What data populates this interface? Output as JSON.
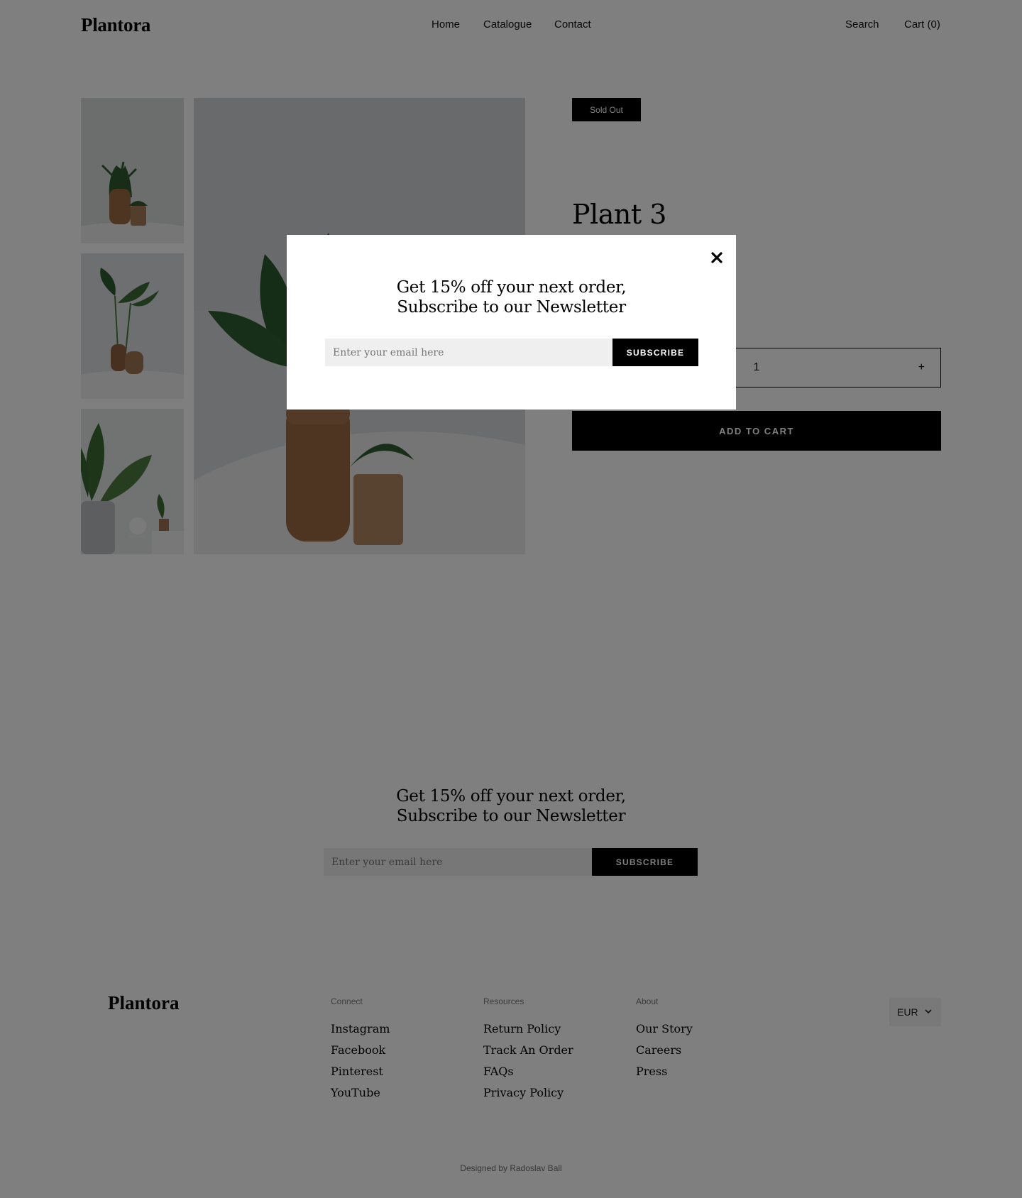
{
  "header": {
    "logo": "Plantora",
    "nav": [
      {
        "label": "Home"
      },
      {
        "label": "Catalogue"
      },
      {
        "label": "Contact"
      }
    ],
    "search_label": "Search",
    "cart_label": "Cart (0)"
  },
  "product": {
    "badge": "Sold Out",
    "title": "Plant 3",
    "quantity": {
      "minus": "−",
      "value": "1",
      "plus": "+"
    },
    "add_to_cart_label": "ADD TO CART",
    "gallery": [
      {
        "alt": "plant-thumbnail-1"
      },
      {
        "alt": "plant-thumbnail-2"
      },
      {
        "alt": "plant-thumbnail-3"
      },
      {
        "alt": "plant-main-image"
      }
    ]
  },
  "newsletter": {
    "heading_line1": "Get 15% off your next order,",
    "heading_line2": "Subscribe to our Newsletter",
    "placeholder": "Enter your email here",
    "button_label": "SUBSCRIBE"
  },
  "modal": {
    "heading_line1": "Get 15% off your next order,",
    "heading_line2": "Subscribe to our Newsletter",
    "placeholder": "Enter your email here",
    "button_label": "SUBSCRIBE",
    "close_icon": "close-icon"
  },
  "footer": {
    "logo": "Plantora",
    "columns": [
      {
        "title": "Connect",
        "links": [
          "Instagram",
          "Facebook",
          "Pinterest",
          "YouTube"
        ]
      },
      {
        "title": "Resources",
        "links": [
          "Return Policy",
          "Track An Order",
          "FAQs",
          "Privacy Policy"
        ]
      },
      {
        "title": "About",
        "links": [
          "Our Story",
          "Careers",
          "Press"
        ]
      }
    ],
    "currency": "EUR",
    "credit": "Designed by Radoslav Ball"
  },
  "colors": {
    "overlay": "#000000",
    "accent": "#000000",
    "input_bg": "#efefef"
  }
}
